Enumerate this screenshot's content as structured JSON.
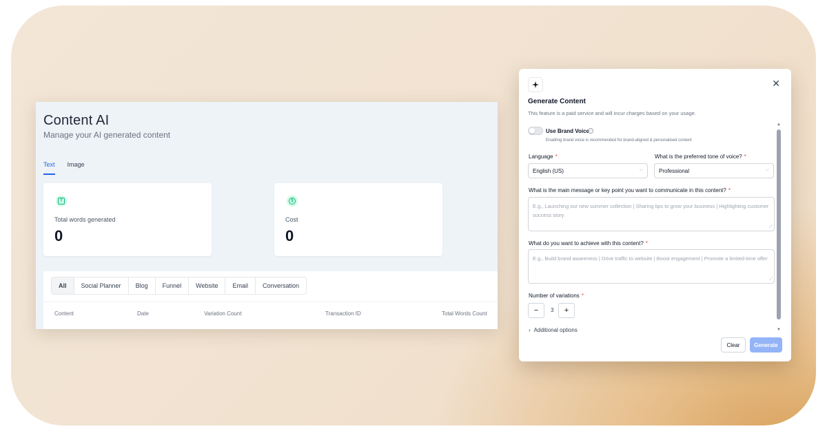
{
  "app": {
    "title": "Content AI",
    "subtitle": "Manage your AI generated content",
    "tabs": [
      {
        "label": "Text",
        "active": true
      },
      {
        "label": "Image",
        "active": false
      }
    ],
    "stats": [
      {
        "icon": "text-icon",
        "icon_glyph": "T",
        "label": "Total words generated",
        "value": "0"
      },
      {
        "icon": "dollar-icon",
        "icon_glyph": "$",
        "label": "Cost",
        "value": "0"
      }
    ],
    "filters": [
      "All",
      "Social Planner",
      "Blog",
      "Funnel",
      "Website",
      "Email",
      "Conversation"
    ],
    "active_filter": "All",
    "columns": [
      "Content",
      "Date",
      "Variation Count",
      "Transaction ID",
      "Total Words Count"
    ]
  },
  "modal": {
    "icon": "sparkle-icon",
    "close_glyph": "✕",
    "title": "Generate Content",
    "description": "This feature is a paid service and will incur charges based on your usage.",
    "brand_voice": {
      "label": "Use Brand Voice",
      "enabled": false,
      "hint": "Enabling brand voice is recommended for brand-aligned & personalised content"
    },
    "language": {
      "label": "Language",
      "value": "English (US)"
    },
    "tone": {
      "label": "What is the preferred tone of voice?",
      "value": "Professional"
    },
    "main_message": {
      "label": "What is the main message or key point you want to communicate in this content?",
      "placeholder": "E.g., Launching our new summer collection | Sharing tips to grow your business | Highlighting customer success story"
    },
    "goal": {
      "label": "What do you want to achieve with this content?",
      "placeholder": "E.g., Build brand awareness | Drive traffic to website | Boost engagement | Promote a limited-time offer"
    },
    "variations": {
      "label": "Number of variations",
      "value": "3",
      "minus": "−",
      "plus": "+"
    },
    "additional_options": "Additional options",
    "buttons": {
      "clear": "Clear",
      "generate": "Generate"
    },
    "required_mark": "*"
  },
  "colors": {
    "accent": "#2563eb",
    "generate_button": "#93b4f7",
    "required": "#ef4444",
    "stat_icon": "#10b981"
  }
}
